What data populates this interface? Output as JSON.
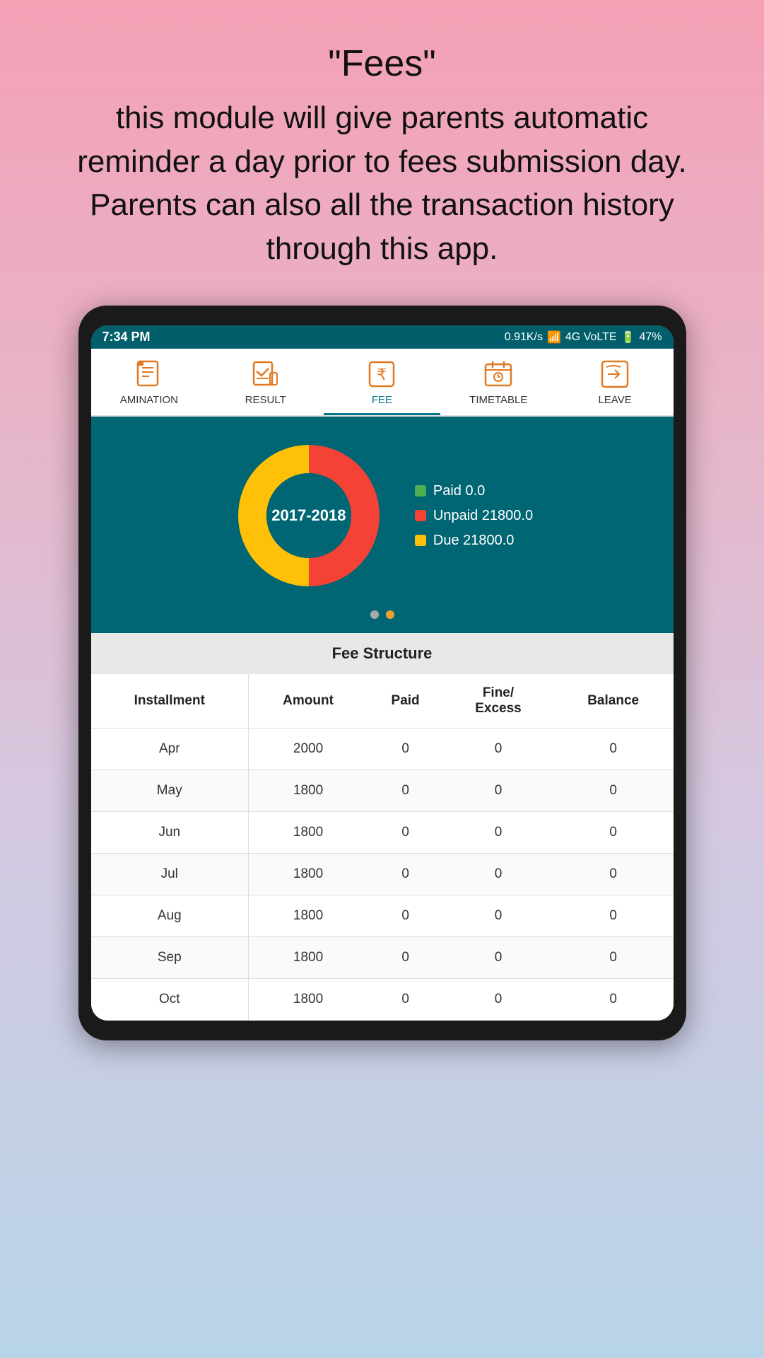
{
  "header": {
    "title": "\"Fees\"",
    "description": "this module will give parents automatic reminder a day prior to fees submission day. Parents can also all the transaction history through this app."
  },
  "status_bar": {
    "time": "7:34 PM",
    "network_speed": "0.91K/s",
    "signal_info": "4G VoLTE",
    "battery": "47%"
  },
  "nav_tabs": [
    {
      "label": "AMINATION",
      "icon": "exam-icon",
      "active": false
    },
    {
      "label": "RESULT",
      "icon": "result-icon",
      "active": false
    },
    {
      "label": "FEE",
      "icon": "fee-icon",
      "active": true
    },
    {
      "label": "TIMETABLE",
      "icon": "timetable-icon",
      "active": false
    },
    {
      "label": "LEAVE",
      "icon": "leave-icon",
      "active": false
    }
  ],
  "chart": {
    "year": "2017-2018",
    "legend": [
      {
        "label": "Paid 0.0",
        "color": "#4caf50"
      },
      {
        "label": "Unpaid 21800.0",
        "color": "#f44336"
      },
      {
        "label": "Due 21800.0",
        "color": "#ffc107"
      }
    ],
    "segments": [
      {
        "value": 50,
        "color": "#f44336"
      },
      {
        "value": 50,
        "color": "#ffc107"
      }
    ]
  },
  "fee_structure": {
    "title": "Fee Structure",
    "columns": [
      "Installment",
      "Amount",
      "Paid",
      "Fine/\nExcess",
      "Balance"
    ],
    "rows": [
      {
        "installment": "Apr",
        "amount": "2000",
        "paid": "0",
        "fine_excess": "0",
        "balance": "0"
      },
      {
        "installment": "May",
        "amount": "1800",
        "paid": "0",
        "fine_excess": "0",
        "balance": "0"
      },
      {
        "installment": "Jun",
        "amount": "1800",
        "paid": "0",
        "fine_excess": "0",
        "balance": "0"
      },
      {
        "installment": "Jul",
        "amount": "1800",
        "paid": "0",
        "fine_excess": "0",
        "balance": "0"
      },
      {
        "installment": "Aug",
        "amount": "1800",
        "paid": "0",
        "fine_excess": "0",
        "balance": "0"
      },
      {
        "installment": "Sep",
        "amount": "1800",
        "paid": "0",
        "fine_excess": "0",
        "balance": "0"
      },
      {
        "installment": "Oct",
        "amount": "1800",
        "paid": "0",
        "fine_excess": "0",
        "balance": "0"
      }
    ]
  }
}
